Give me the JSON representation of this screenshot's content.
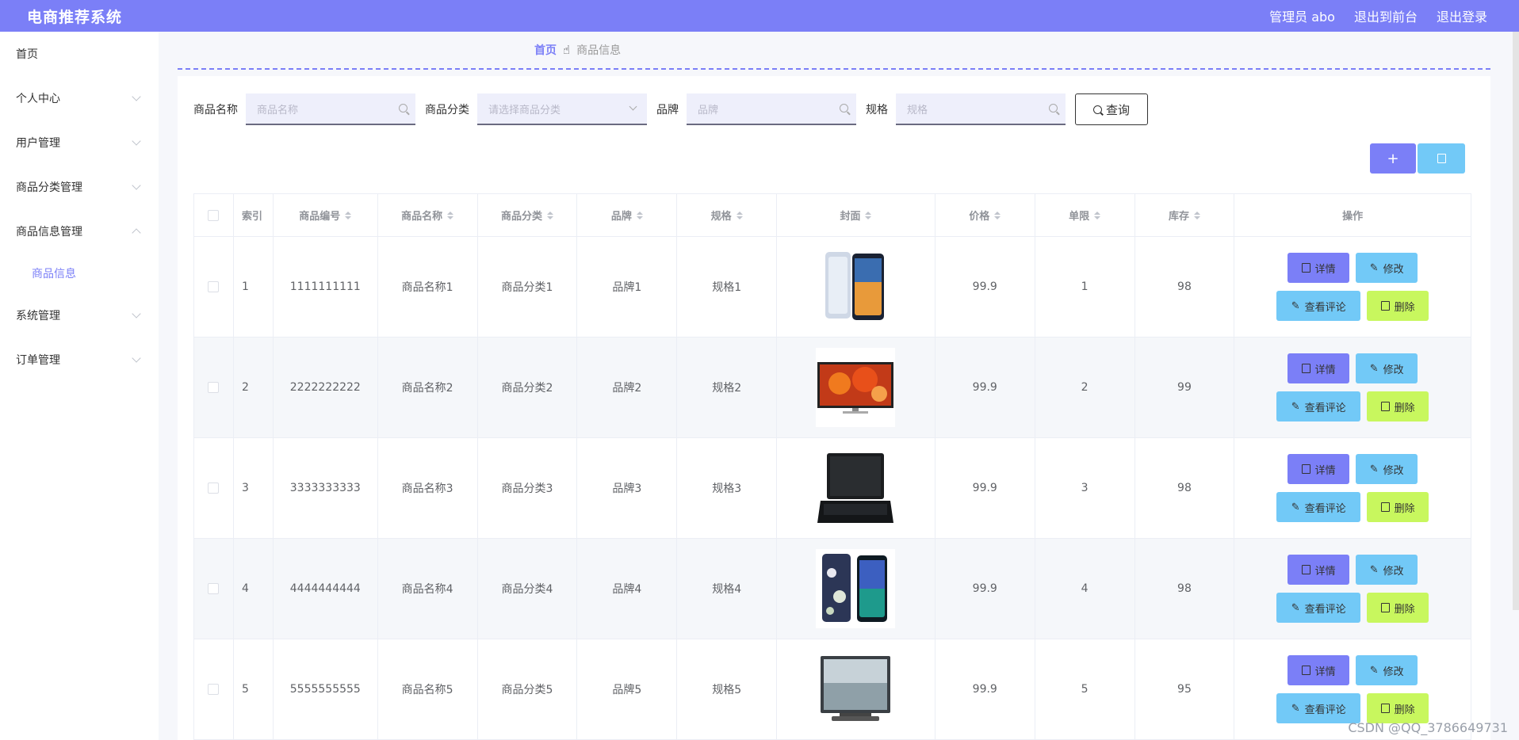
{
  "header": {
    "title": "电商推荐系统",
    "user": "管理员 abo",
    "to_front": "退出到前台",
    "logout": "退出登录"
  },
  "sidebar": {
    "items": [
      {
        "label": "首页"
      },
      {
        "label": "个人中心"
      },
      {
        "label": "用户管理"
      },
      {
        "label": "商品分类管理"
      },
      {
        "label": "商品信息管理"
      },
      {
        "label": "商品信息"
      },
      {
        "label": "系统管理"
      },
      {
        "label": "订单管理"
      }
    ]
  },
  "breadcrumb": {
    "home": "首页",
    "separator_icon": "hand-icon",
    "current": "商品信息"
  },
  "search": {
    "name_label": "商品名称",
    "name_placeholder": "商品名称",
    "category_label": "商品分类",
    "category_placeholder": "请选择商品分类",
    "brand_label": "品牌",
    "brand_placeholder": "品牌",
    "spec_label": "规格",
    "spec_placeholder": "规格",
    "query_label": "查询"
  },
  "toolbar": {
    "add_label": "+"
  },
  "table": {
    "headers": {
      "index": "索引",
      "code": "商品编号",
      "name": "商品名称",
      "category": "商品分类",
      "brand": "品牌",
      "spec": "规格",
      "cover": "封面",
      "price": "价格",
      "limit": "单限",
      "stock": "库存",
      "ops": "操作"
    },
    "rows": [
      {
        "index": "1",
        "code": "1111111111",
        "name": "商品名称1",
        "category": "商品分类1",
        "brand": "品牌1",
        "spec": "规格1",
        "price": "99.9",
        "limit": "1",
        "stock": "98"
      },
      {
        "index": "2",
        "code": "2222222222",
        "name": "商品名称2",
        "category": "商品分类2",
        "brand": "品牌2",
        "spec": "规格2",
        "price": "99.9",
        "limit": "2",
        "stock": "99"
      },
      {
        "index": "3",
        "code": "3333333333",
        "name": "商品名称3",
        "category": "商品分类3",
        "brand": "品牌3",
        "spec": "规格3",
        "price": "99.9",
        "limit": "3",
        "stock": "98"
      },
      {
        "index": "4",
        "code": "4444444444",
        "name": "商品名称4",
        "category": "商品分类4",
        "brand": "品牌4",
        "spec": "规格4",
        "price": "99.9",
        "limit": "4",
        "stock": "98"
      },
      {
        "index": "5",
        "code": "5555555555",
        "name": "商品名称5",
        "category": "商品分类5",
        "brand": "品牌5",
        "spec": "规格5",
        "price": "99.9",
        "limit": "5",
        "stock": "95"
      }
    ],
    "actions": {
      "detail": "详情",
      "edit": "修改",
      "review": "查看评论",
      "remove": "删除"
    }
  },
  "watermark": "CSDN @QQ_3786649731",
  "colors": {
    "primary": "#7b7ff7",
    "info": "#72c9f7",
    "success": "#c8f75e"
  }
}
